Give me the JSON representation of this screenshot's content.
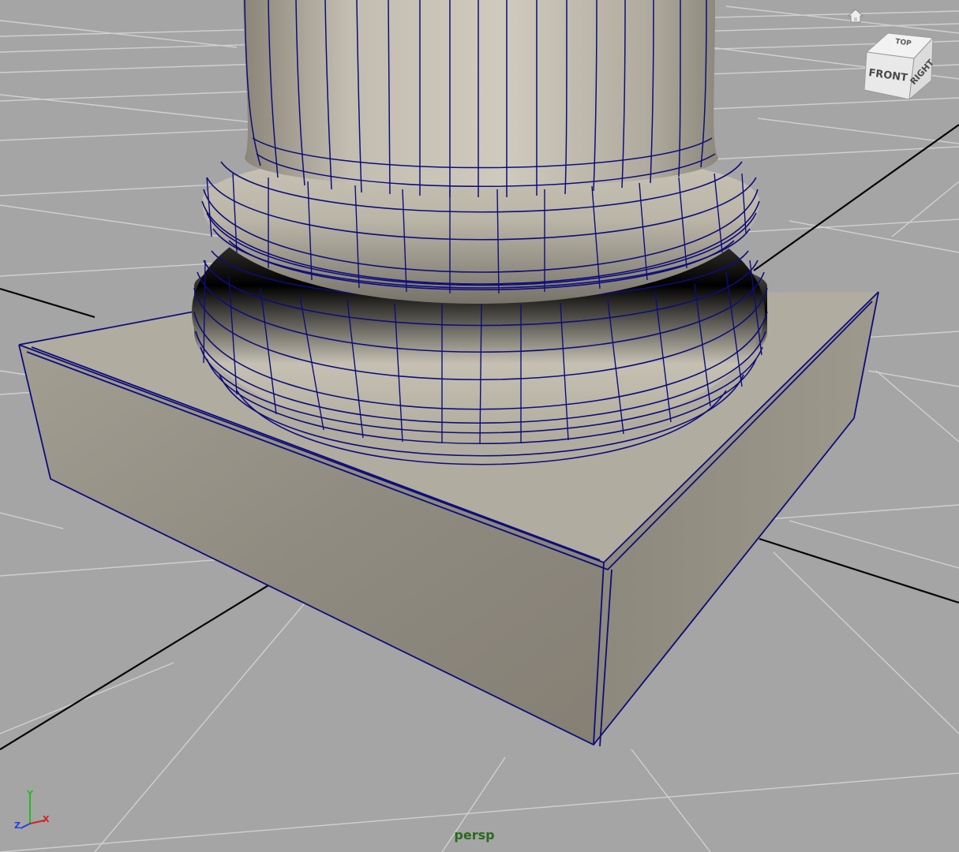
{
  "viewport": {
    "camera_label": "persp",
    "background_color": "#a5a5a5",
    "grid_color": "#cfcfcf",
    "axis_line_color": "#050505",
    "wireframe_color": "#0d0d7a",
    "stone_color": "#bdb7a8"
  },
  "view_cube": {
    "faces": {
      "top": "TOP",
      "front": "FRONT",
      "right": "RIGHT"
    },
    "home_icon": "home-icon"
  },
  "axis_gizmo": {
    "x_label": "X",
    "y_label": "Y",
    "z_label": "Z",
    "x_color": "#d42020",
    "y_color": "#20c020",
    "z_color": "#2040e0"
  }
}
